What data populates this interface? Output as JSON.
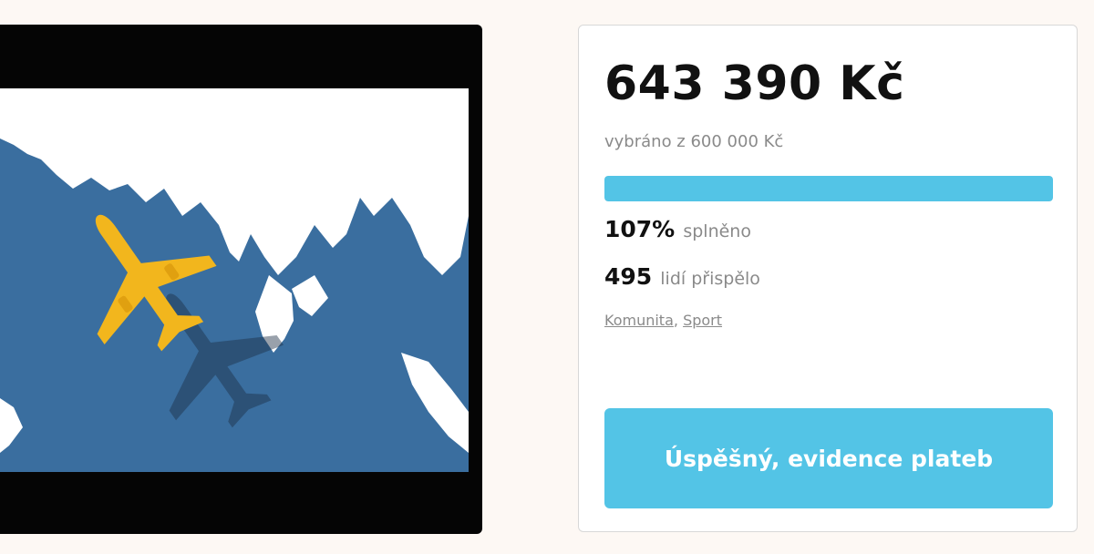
{
  "video": {
    "icons": [
      "airplane-icon"
    ]
  },
  "campaign": {
    "amount": "643 390 Kč",
    "goal_text": "vybráno z 600 000 Kč",
    "progress": {
      "fraction_filled": 1.0,
      "color": "#53c4e6"
    },
    "percent_value": "107%",
    "percent_label": "splněno",
    "donors_value": "495",
    "donors_label": "lidí přispělo",
    "tags": [
      "Komunita",
      "Sport"
    ],
    "tag_separator": ",",
    "status_button_label": "Úspěšný, evidence plateb"
  },
  "colors": {
    "accent": "#53c4e6",
    "sea": "#3a6e9f",
    "land": "#ffffff",
    "airplane": "#f2b61d"
  }
}
